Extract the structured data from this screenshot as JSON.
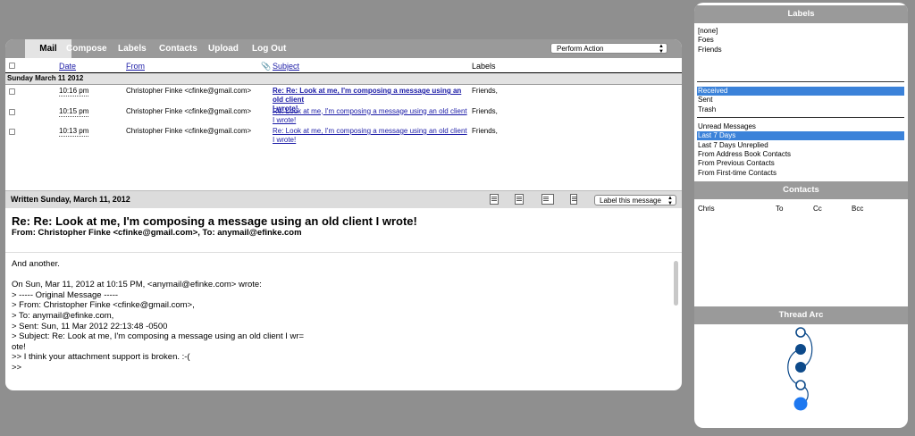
{
  "nav": {
    "tabs": [
      "Mail",
      "Compose",
      "Labels",
      "Contacts",
      "Upload",
      "Log Out"
    ],
    "action_select": "Perform Action"
  },
  "columns": {
    "date": "Date",
    "from": "From",
    "subject": "Subject",
    "labels": "Labels"
  },
  "group_header": "Sunday March 11 2012",
  "messages": [
    {
      "time": "10:16 pm",
      "from": "Christopher Finke <cfinke@gmail.com>",
      "subject_l1": "Re: Re: Look at me, I'm composing a message using an old client",
      "subject_l2": "I wrote!",
      "labels": "Friends,",
      "unread": true
    },
    {
      "time": "10:15 pm",
      "from": "Christopher Finke <cfinke@gmail.com>",
      "subject_l1": "Re: Look at me, I'm composing a message using an old client",
      "subject_l2": "I wrote!",
      "labels": "Friends,",
      "unread": false
    },
    {
      "time": "10:13 pm",
      "from": "Christopher Finke <cfinke@gmail.com>",
      "subject_l1": "Re: Look at me, I'm composing a message using an old client",
      "subject_l2": "I wrote!",
      "labels": "Friends,",
      "unread": false
    }
  ],
  "reading": {
    "written": "Written Sunday, March 11, 2012",
    "label_select": "Label this message",
    "subject": "Re: Re: Look at me, I'm composing a message using an old client I wrote!",
    "from_line": "From: Christopher Finke <cfinke@gmail.com>, To: anymail@efinke.com",
    "body": "And another.\n\nOn Sun, Mar 11, 2012 at 10:15 PM, <anymail@efinke.com> wrote:\n> ----- Original Message -----\n> From: Christopher Finke <cfinke@gmail.com>,\n> To: anymail@efinke.com,\n> Sent: Sun, 11 Mar 2012 22:13:48 -0500\n> Subject: Re: Look at me, I'm composing a message using an old client I wr=\note!\n>> I think your attachment support is broken. :-(\n>>"
  },
  "side": {
    "labels_title": "Labels",
    "labels": [
      "[none]",
      "Foes",
      "Friends"
    ],
    "folders": [
      "Received",
      "Sent",
      "Trash"
    ],
    "views": [
      "Unread Messages",
      "Last 7 Days",
      "Last 7 Days Unreplied",
      "From Address Book Contacts",
      "From Previous Contacts",
      "From First-time Contacts"
    ],
    "selected_folder": "Received",
    "selected_view": "Last 7 Days",
    "contacts_title": "Contacts",
    "contact_columns": [
      "Chris",
      "To",
      "Cc",
      "Bcc"
    ],
    "thread_title": "Thread Arc"
  },
  "colors": {
    "background": "#8f8f8f",
    "header_gray": "#9a9a9a",
    "selection": "#3b82d9",
    "link": "#1a1aa6",
    "arc_dark": "#0d4a8a",
    "arc_bright": "#1e78f0"
  }
}
